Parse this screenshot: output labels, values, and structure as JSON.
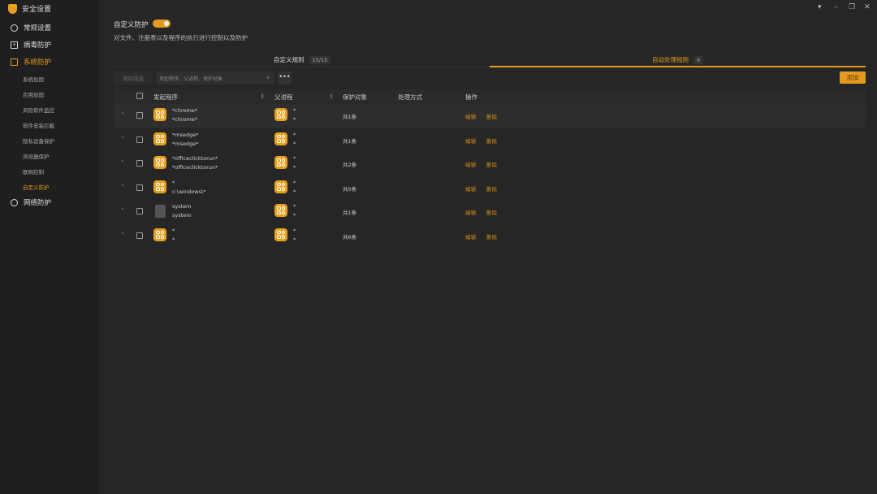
{
  "app_title": "安全设置",
  "window_controls": [
    "menu",
    "minimize",
    "restore",
    "close"
  ],
  "sidebar": {
    "items": [
      {
        "label": "常规设置",
        "icon": "gear-icon"
      },
      {
        "label": "病毒防护",
        "icon": "virus-icon"
      },
      {
        "label": "系统防护",
        "icon": "grid-icon",
        "active": true
      },
      {
        "label": "网络防护",
        "icon": "globe-icon"
      }
    ],
    "sub_items": [
      {
        "label": "系统加固"
      },
      {
        "label": "应用加固"
      },
      {
        "label": "风险软件监控"
      },
      {
        "label": "软件安装拦截"
      },
      {
        "label": "隐私设备保护"
      },
      {
        "label": "浏览器保护"
      },
      {
        "label": "联网控制"
      },
      {
        "label": "自定义防护",
        "active": true
      }
    ]
  },
  "header": {
    "title": "自定义防护",
    "toggle_on": true,
    "description": "对文件、注册表以及程序的执行进行控制以及防护"
  },
  "tabs": [
    {
      "label": "自定义规则",
      "badge": "15/15"
    },
    {
      "label": "自动处理规则",
      "badge": "6",
      "active": true
    }
  ],
  "toolbar": {
    "clear_filter": "清除筛选",
    "search_placeholder": "发起程序、父进程、保护对象",
    "more": "•••",
    "add": "添加"
  },
  "table": {
    "columns": [
      "发起程序",
      "父进程",
      "保护对象",
      "处理方式",
      "操作"
    ],
    "rows": [
      {
        "prog1": "*chrome*",
        "prog2": "*chrome*",
        "icon": "app",
        "parent1": "*",
        "parent2": "*",
        "count": "共1条",
        "edit": "编辑",
        "del": "删除"
      },
      {
        "prog1": "*msedge*",
        "prog2": "*msedge*",
        "icon": "app",
        "parent1": "*",
        "parent2": "*",
        "count": "共1条",
        "edit": "编辑",
        "del": "删除"
      },
      {
        "prog1": "*officeclicktorun*",
        "prog2": "*officeclicktorun*",
        "icon": "app",
        "parent1": "*",
        "parent2": "*",
        "count": "共2条",
        "edit": "编辑",
        "del": "删除"
      },
      {
        "prog1": "*",
        "prog2": "c:\\windows\\*",
        "icon": "app",
        "parent1": "*",
        "parent2": "*",
        "count": "共5条",
        "edit": "编辑",
        "del": "删除"
      },
      {
        "prog1": "system",
        "prog2": "system",
        "icon": "file",
        "parent1": "*",
        "parent2": "*",
        "count": "共1条",
        "edit": "编辑",
        "del": "删除"
      },
      {
        "prog1": "*",
        "prog2": "*",
        "icon": "app",
        "parent1": "*",
        "parent2": "*",
        "count": "共6条",
        "edit": "编辑",
        "del": "删除"
      }
    ]
  },
  "colors": {
    "accent": "#e39a1e",
    "sidebar_bg": "#1f1f1f",
    "main_bg": "#262626"
  }
}
